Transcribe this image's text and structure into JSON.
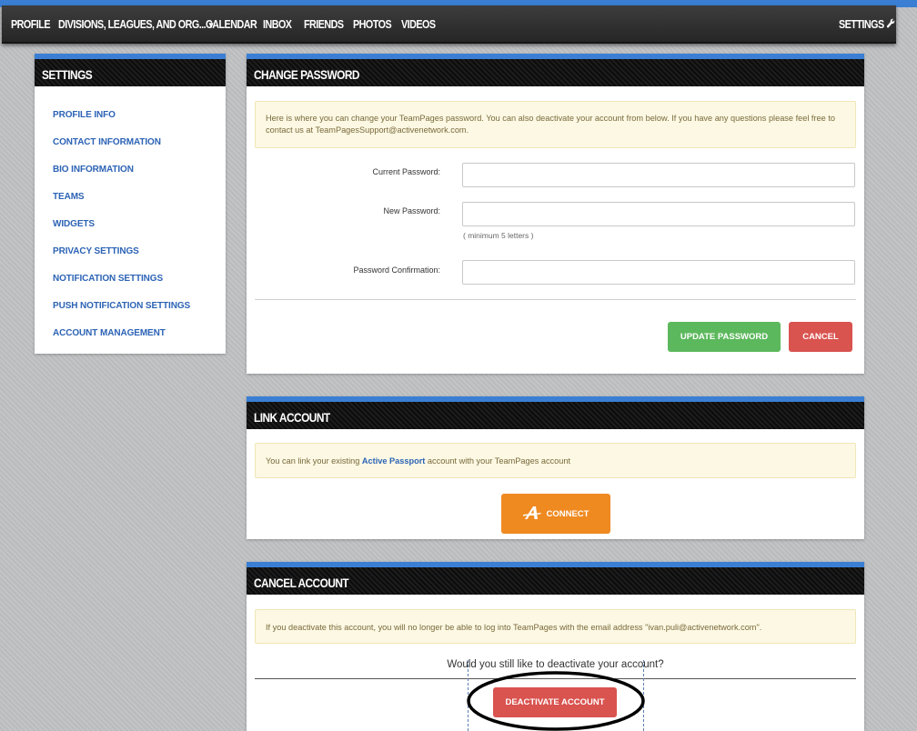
{
  "nav": {
    "items": [
      "PROFILE",
      "DIVISIONS, LEAGUES, AND ORG...",
      "CALENDAR",
      "INBOX",
      "FRIENDS",
      "PHOTOS",
      "VIDEOS"
    ],
    "settings": "SETTINGS"
  },
  "sidebar": {
    "title": "SETTINGS",
    "links": [
      "PROFILE INFO",
      "CONTACT INFORMATION",
      "BIO INFORMATION",
      "TEAMS",
      "WIDGETS",
      "PRIVACY SETTINGS",
      "NOTIFICATION SETTINGS",
      "PUSH NOTIFICATION SETTINGS",
      "ACCOUNT MANAGEMENT"
    ]
  },
  "change_password": {
    "title": "CHANGE PASSWORD",
    "notice": "Here is where you can change your TeamPages password. You can also deactivate your account from below. If you have any questions please feel free to contact us at TeamPagesSupport@activenetwork.com.",
    "current_label": "Current Password:",
    "new_label": "New Password:",
    "hint": "( minimum 5 letters )",
    "confirm_label": "Password Confirmation:",
    "update_button": "UPDATE PASSWORD",
    "cancel_button": "CANCEL"
  },
  "link_account": {
    "title": "LINK ACCOUNT",
    "notice_before": "You can link your existing ",
    "notice_link": "Active Passport",
    "notice_after": " account with your TeamPages account",
    "connect_button": "CONNECT"
  },
  "cancel_account": {
    "title": "CANCEL ACCOUNT",
    "notice": "If you deactivate this account, you will no longer be able to log into TeamPages with the email address \"ivan.puli@activenetwork.com\".",
    "question": "Would you still like to deactivate your account?",
    "deactivate_button": "DEACTIVATE ACCOUNT"
  }
}
